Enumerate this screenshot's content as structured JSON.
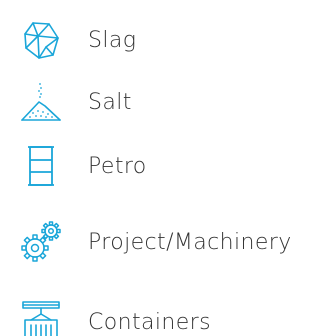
{
  "accent_color": "#1aa6d9",
  "text_color": "#333333",
  "items": [
    {
      "label": "Slag",
      "icon": "slag-rock-icon"
    },
    {
      "label": "Salt",
      "icon": "salt-pile-icon"
    },
    {
      "label": "Petro",
      "icon": "oil-barrel-icon"
    },
    {
      "label": "Project/Machinery",
      "icon": "gears-icon"
    },
    {
      "label": "Containers",
      "icon": "container-crane-icon"
    }
  ]
}
